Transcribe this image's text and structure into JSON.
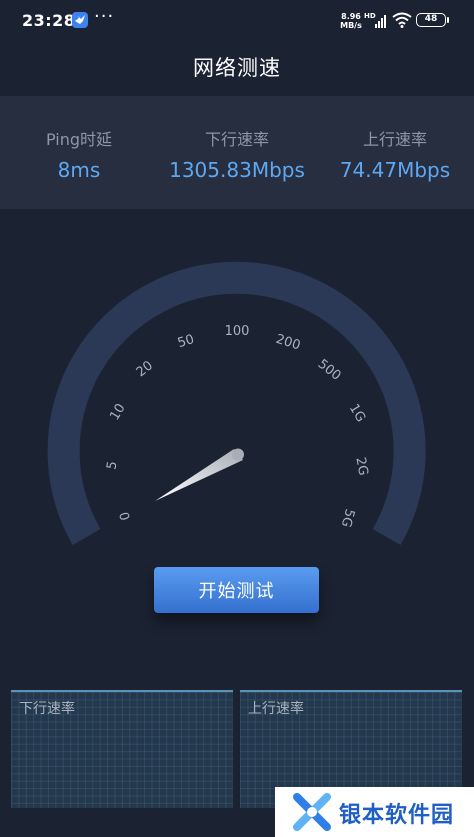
{
  "status_bar": {
    "time": "23:28",
    "more": "···",
    "net_speed_value": "8.96",
    "net_speed_unit": "MB/s",
    "hd_label": "HD",
    "battery": "48",
    "icons": [
      "app-bird-icon",
      "hd-signal-icon",
      "wifi-icon",
      "battery-icon"
    ]
  },
  "header": {
    "title": "网络测速"
  },
  "stats": {
    "ping": {
      "label": "Ping时延",
      "value": "8ms"
    },
    "download": {
      "label": "下行速率",
      "value": "1305.83Mbps"
    },
    "upload": {
      "label": "上行速率",
      "value": "74.47Mbps"
    }
  },
  "gauge": {
    "ticks": [
      "0",
      "5",
      "10",
      "20",
      "50",
      "100",
      "200",
      "500",
      "1G",
      "2G",
      "5G"
    ]
  },
  "actions": {
    "start_label": "开始测试"
  },
  "graphs": {
    "download_label": "下行速率",
    "upload_label": "上行速率"
  },
  "watermark": {
    "text": "银本软件园"
  },
  "colors": {
    "background": "#1b2232",
    "panel": "#262e40",
    "accent": "#5ea8f2",
    "button": "#4a8ae6"
  }
}
